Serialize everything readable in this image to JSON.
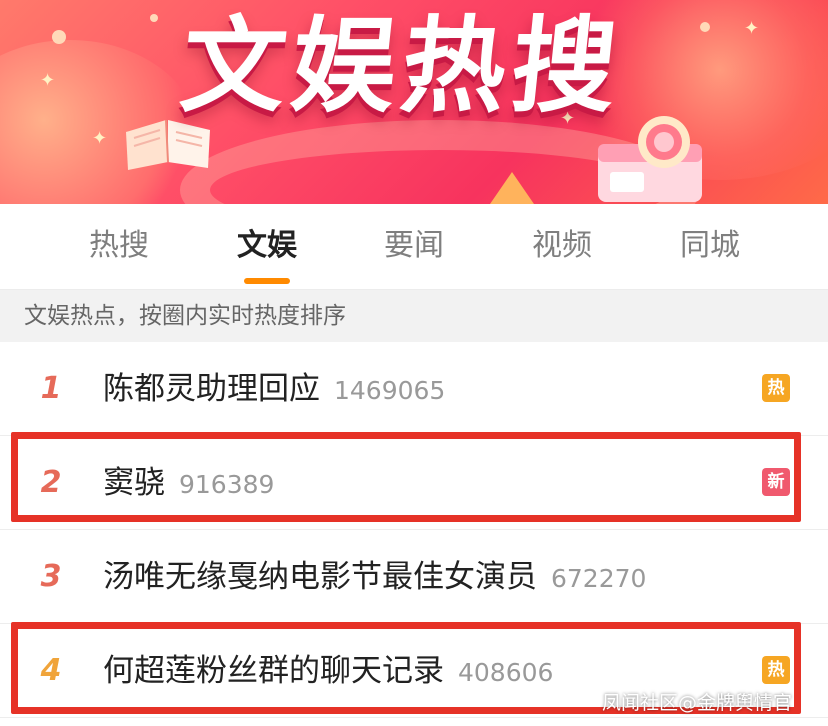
{
  "banner": {
    "title": "文娱热搜"
  },
  "tabs": [
    {
      "label": "热搜",
      "active": false
    },
    {
      "label": "文娱",
      "active": true
    },
    {
      "label": "要闻",
      "active": false
    },
    {
      "label": "视频",
      "active": false
    },
    {
      "label": "同城",
      "active": false
    }
  ],
  "subheader": "文娱热点，按圈内实时热度排序",
  "list": [
    {
      "rank": "1",
      "keyword": "陈都灵助理回应",
      "count": "1469065",
      "badge": "热",
      "badge_type": "hot"
    },
    {
      "rank": "2",
      "keyword": "窦骁",
      "count": "916389",
      "badge": "新",
      "badge_type": "new"
    },
    {
      "rank": "3",
      "keyword": "汤唯无缘戛纳电影节最佳女演员",
      "count": "672270",
      "badge": "",
      "badge_type": "none"
    },
    {
      "rank": "4",
      "keyword": "何超莲粉丝群的聊天记录",
      "count": "408606",
      "badge": "热",
      "badge_type": "hot"
    }
  ],
  "watermark": "凤闻社区@金牌舆情官",
  "colors": {
    "accent_orange": "#ff8a00",
    "highlight_red": "#e63227",
    "badge_hot": "#f6a623",
    "badge_new": "#f0596e",
    "rank_red": "#e66a59",
    "rank_orange": "#f0a43a"
  }
}
